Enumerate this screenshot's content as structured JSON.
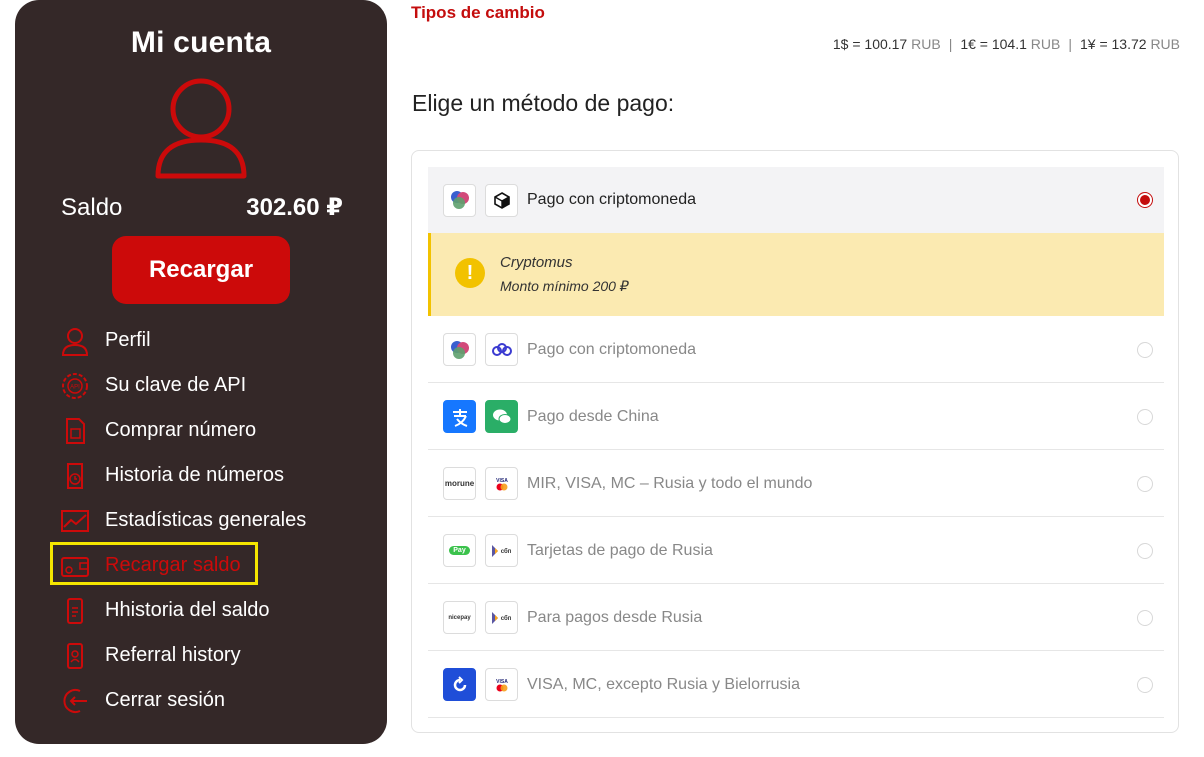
{
  "sidebar": {
    "title": "Mi cuenta",
    "balance_label": "Saldo",
    "balance_value": "302.60 ₽",
    "topup_button": "Recargar",
    "menu": [
      {
        "label": "Perfil",
        "icon": "user-icon"
      },
      {
        "label": "Su clave de API",
        "icon": "api-key-icon"
      },
      {
        "label": "Comprar número",
        "icon": "sim-card-icon"
      },
      {
        "label": "Historia de números",
        "icon": "history-icon"
      },
      {
        "label": "Estadísticas generales",
        "icon": "chart-icon"
      },
      {
        "label": "Recargar saldo",
        "icon": "wallet-icon",
        "active": true
      },
      {
        "label": "Hhistoria del saldo",
        "icon": "balance-history-icon"
      },
      {
        "label": "Referral history",
        "icon": "referral-icon"
      },
      {
        "label": "Cerrar sesión",
        "icon": "logout-icon"
      }
    ]
  },
  "rates": {
    "title": "Tipos de cambio",
    "usd": "1$ = 100.17",
    "eur": "1€ = 104.1",
    "cny": "1¥ = 13.72",
    "unit": "RUB",
    "separator": "|"
  },
  "payment": {
    "title": "Elige un método de pago:",
    "notice": {
      "line1": "Cryptomus",
      "line2": "Monto mínimo 200 ₽",
      "icon_text": "!"
    },
    "methods": [
      {
        "label": "Pago con criptomoneda",
        "selected": true
      },
      {
        "label": "Pago con criptomoneda",
        "selected": false
      },
      {
        "label": "Pago desde China",
        "selected": false
      },
      {
        "label": "MIR, VISA, MC – Rusia y todo el mundo",
        "selected": false,
        "logo1_text": "morune",
        "logo2_text": "VISA"
      },
      {
        "label": "Tarjetas de pago de Rusia",
        "selected": false,
        "logo1_text": "Pay",
        "logo2_text": "сбп"
      },
      {
        "label": "Para pagos desde Rusia",
        "selected": false,
        "logo1_text": "nicepay",
        "logo2_text": "сбп"
      },
      {
        "label": "VISA, MC, excepto Rusia y Bielorrusia",
        "selected": false,
        "logo2_text": "VISA"
      }
    ]
  },
  "colors": {
    "sidebar_bg": "#342828",
    "accent_red": "#cc0a0a",
    "notice_bg": "#fbeab1",
    "notice_accent": "#f2c200"
  }
}
